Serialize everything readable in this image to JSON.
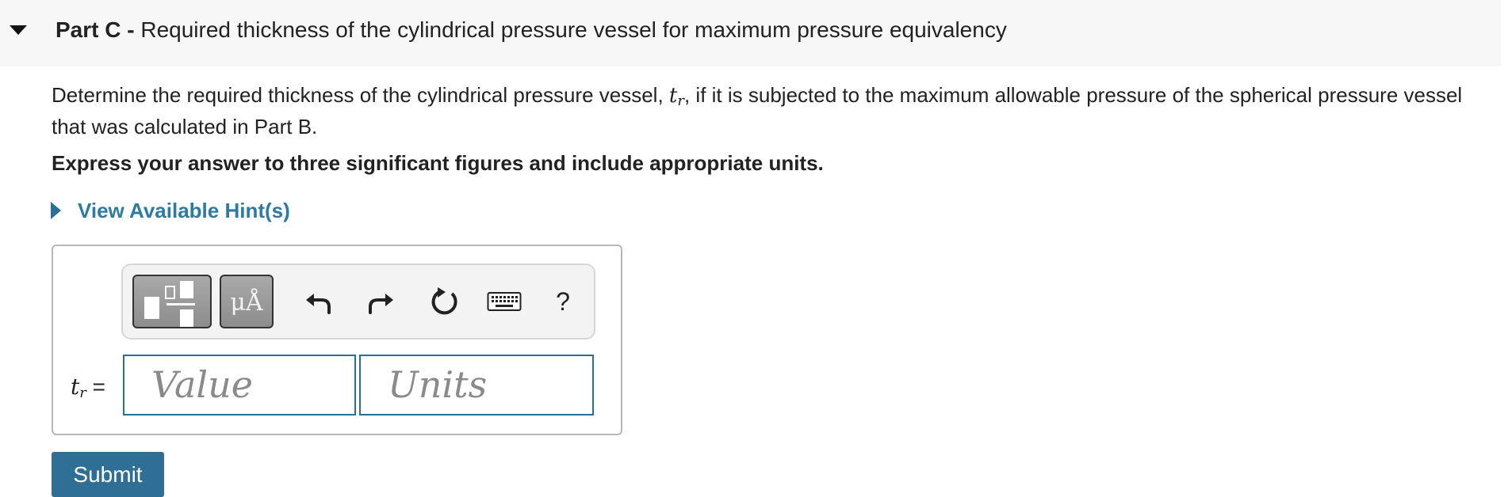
{
  "header": {
    "part_label": "Part C -",
    "title": "Required thickness of the cylindrical pressure vessel for maximum pressure equivalency"
  },
  "question": {
    "text_before": "Determine the required thickness of the cylindrical pressure vessel, ",
    "symbol": "t",
    "symbol_sub": "r",
    "text_after": ", if it is subjected to the maximum allowable pressure of the spherical pressure vessel that was calculated in Part B.",
    "instruction": "Express your answer to three significant figures and include appropriate units."
  },
  "hint": {
    "label": "View Available Hint(s)"
  },
  "toolbar": {
    "units_glyph": "μÅ",
    "help_label": "?"
  },
  "answer": {
    "var_symbol": "t",
    "var_sub": "r",
    "equals": "=",
    "value_placeholder": "Value",
    "units_placeholder": "Units"
  },
  "submit_label": "Submit",
  "colors": {
    "accent": "#2f6f95",
    "link": "#2d7aa3",
    "header_bg": "#f7f7f7"
  }
}
